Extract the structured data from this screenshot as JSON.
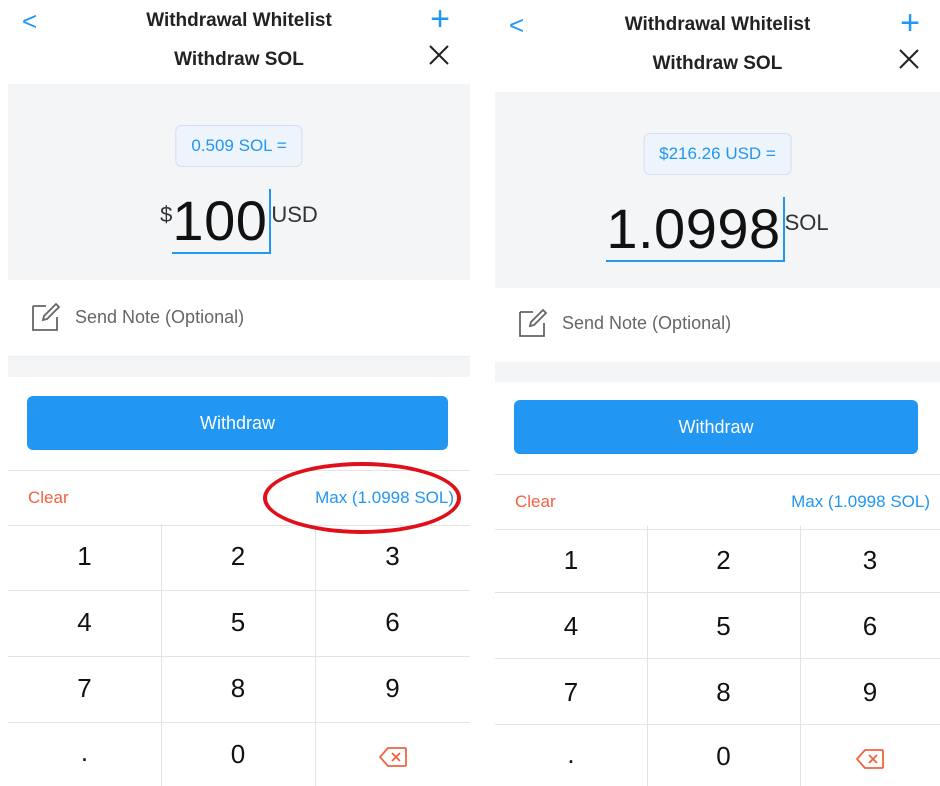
{
  "colors": {
    "accent": "#2196F3",
    "clear": "#F26241",
    "annotation": "#e0101a",
    "panel_bg": "#f4f5f7"
  },
  "left": {
    "header": {
      "title": "Withdrawal Whitelist",
      "subtitle": "Withdraw SOL",
      "back_icon": "<",
      "add_icon": "+"
    },
    "amount": {
      "rate": "0.509 SOL =",
      "currency_symbol": "$",
      "value": "100",
      "unit": "USD"
    },
    "note": {
      "label": "Send Note (Optional)"
    },
    "withdraw_label": "Withdraw",
    "actions": {
      "clear": "Clear",
      "max": "Max (1.0998 SOL)"
    },
    "keys": [
      "1",
      "2",
      "3",
      "4",
      "5",
      "6",
      "7",
      "8",
      "9",
      ".",
      "0"
    ]
  },
  "right": {
    "header": {
      "title": "Withdrawal Whitelist",
      "subtitle": "Withdraw SOL",
      "back_icon": "<",
      "add_icon": "+"
    },
    "amount": {
      "rate": "$216.26 USD =",
      "value": "1.0998",
      "unit": "SOL"
    },
    "note": {
      "label": "Send Note (Optional)"
    },
    "withdraw_label": "Withdraw",
    "actions": {
      "clear": "Clear",
      "max": "Max (1.0998 SOL)"
    },
    "keys": [
      "1",
      "2",
      "3",
      "4",
      "5",
      "6",
      "7",
      "8",
      "9",
      ".",
      "0"
    ]
  }
}
